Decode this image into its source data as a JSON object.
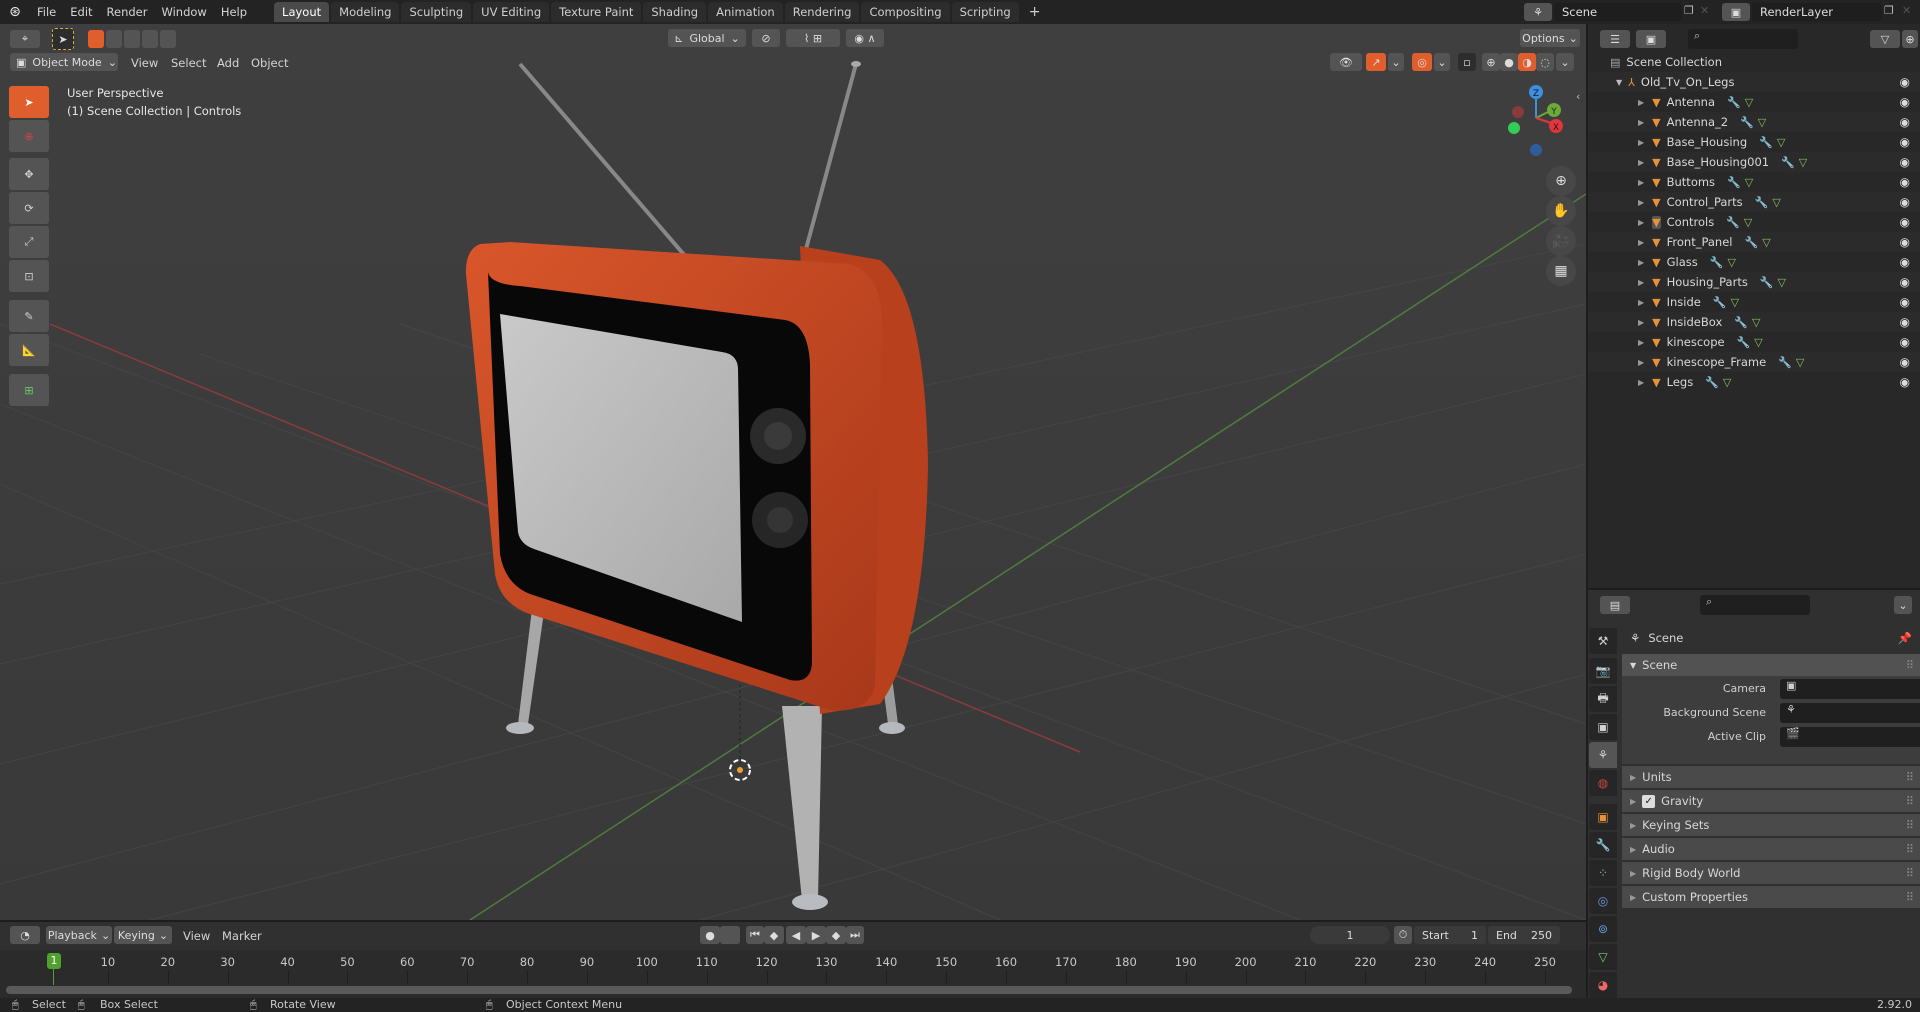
{
  "app": {
    "menu": [
      "File",
      "Edit",
      "Render",
      "Window",
      "Help"
    ],
    "workspace_tabs": [
      "Layout",
      "Modeling",
      "Sculpting",
      "UV Editing",
      "Texture Paint",
      "Shading",
      "Animation",
      "Rendering",
      "Compositing",
      "Scripting"
    ],
    "active_workspace": "Layout",
    "add_tab_label": "+",
    "scene_field": "Scene",
    "view_layer_field": "RenderLayer"
  },
  "viewport": {
    "mode_label": "Object Mode",
    "menus": [
      "View",
      "Select",
      "Add",
      "Object"
    ],
    "transform_orientation": "Global",
    "options_label": "Options",
    "overlay_title": "User Perspective",
    "overlay_subtitle": "(1) Scene Collection | Controls",
    "gizmo_axes": {
      "x": "X",
      "y": "Y",
      "z": "Z"
    },
    "colors": {
      "accent": "#e05d2c",
      "x_axis": "#e0363c",
      "y_axis": "#6ca83a",
      "z_axis": "#3d8fe0",
      "tv_body": "#c9461d"
    }
  },
  "outliner": {
    "root": "Scene Collection",
    "collection": "Old_Tv_On_Legs",
    "objects": [
      "Antenna",
      "Antenna_2",
      "Base_Housing",
      "Base_Housing001",
      "Buttoms",
      "Control_Parts",
      "Controls",
      "Front_Panel",
      "Glass",
      "Housing_Parts",
      "Inside",
      "InsideBox",
      "kinescope",
      "kinescope_Frame",
      "Legs"
    ],
    "active_object": "Controls"
  },
  "properties": {
    "context_label": "Scene",
    "panel_title": "Scene",
    "fields": [
      {
        "label": "Camera",
        "value": ""
      },
      {
        "label": "Background Scene",
        "value": ""
      },
      {
        "label": "Active Clip",
        "value": ""
      }
    ],
    "subpanels": [
      "Units",
      "Gravity",
      "Keying Sets",
      "Audio",
      "Rigid Body World",
      "Custom Properties"
    ],
    "gravity_checked": true
  },
  "timeline": {
    "menus": [
      "Playback",
      "Keying",
      "View",
      "Marker"
    ],
    "current_frame": "1",
    "start_label": "Start",
    "start_value": "1",
    "end_label": "End",
    "end_value": "250",
    "ticks": [
      "10",
      "20",
      "30",
      "40",
      "50",
      "60",
      "70",
      "80",
      "90",
      "100",
      "110",
      "120",
      "130",
      "140",
      "150",
      "160",
      "170",
      "180",
      "190",
      "200",
      "210",
      "220",
      "230",
      "240",
      "250"
    ],
    "playhead_label": "1"
  },
  "statusbar": {
    "items": [
      "Select",
      "Box Select",
      "Rotate View",
      "Object Context Menu"
    ],
    "version": "2.92.0"
  }
}
